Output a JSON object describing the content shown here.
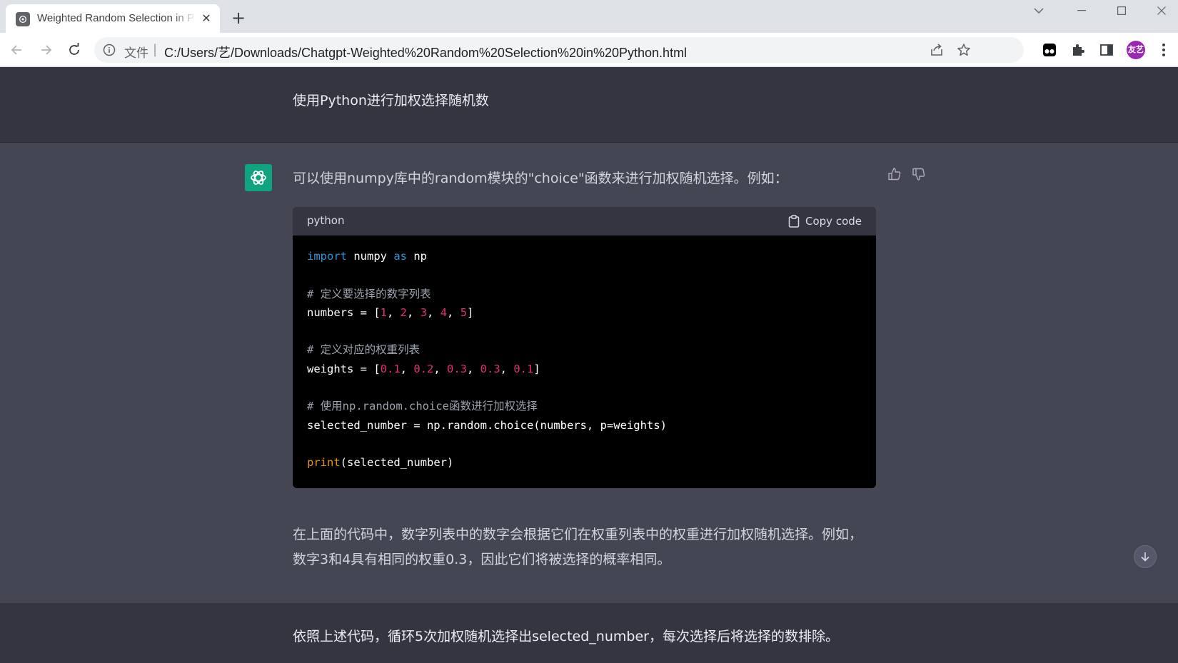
{
  "browser": {
    "tab_title": "Weighted Random Selection in Python",
    "tab_close_glyph": "✕",
    "new_tab_glyph": "+",
    "scheme_label": "文件",
    "url": "C:/Users/艺/Downloads/Chatgpt-Weighted%20Random%20Selection%20in%20Python.html",
    "avatar_text": "友艺"
  },
  "conversation": {
    "user_prompt_1": "使用Python进行加权选择随机数",
    "assistant_intro": "可以使用numpy库中的random模块的\"choice\"函数来进行加权随机选择。例如：",
    "code_language": "python",
    "copy_label": "Copy code",
    "explanation": "在上面的代码中，数字列表中的数字会根据它们在权重列表中的权重进行加权随机选择。例如，数字3和4具有相同的权重0.3，因此它们将被选择的概率相同。",
    "user_prompt_2": "依照上述代码，循环5次加权随机选择出selected_number，每次选择后将选择的数排除。"
  },
  "code": {
    "l1_kw1": "import",
    "l1_mod": " numpy ",
    "l1_kw2": "as",
    "l1_alias": " np",
    "l3_comment": "# 定义要选择的数字列表",
    "l4_var": "numbers = [",
    "l4_n1": "1",
    "l4_n2": "2",
    "l4_n3": "3",
    "l4_n4": "4",
    "l4_n5": "5",
    "l4_end": "]",
    "l6_comment": "# 定义对应的权重列表",
    "l7_var": "weights = [",
    "l7_w1": "0.1",
    "l7_w2": "0.2",
    "l7_w3": "0.3",
    "l7_w4": "0.3",
    "l7_w5": "0.1",
    "l7_end": "]",
    "l9_comment": "# 使用np.random.choice函数进行加权选择",
    "l10": "selected_number = np.random.choice(numbers, p=weights)",
    "l12_fn": "print",
    "l12_args": "(selected_number)",
    "sep": ", "
  },
  "colors": {
    "page_bg": "#444654",
    "user_bg": "#343541",
    "accent_green": "#10a37f",
    "keyword": "#2e95d3",
    "number": "#df3079",
    "function": "#e9950c",
    "comment": "#9ca3af"
  },
  "icons": {
    "favicon": "openai-logo-icon",
    "back": "arrow-left-icon",
    "forward": "arrow-right-icon",
    "reload": "reload-icon",
    "info": "info-icon",
    "share": "share-icon",
    "bookmark": "star-icon",
    "extension_1": "tampermonkey-icon",
    "extensions": "puzzle-icon",
    "side_panel": "side-panel-icon",
    "menu": "kebab-menu-icon",
    "thumbs_up": "thumbs-up-icon",
    "thumbs_down": "thumbs-down-icon",
    "clipboard": "clipboard-icon",
    "scroll_down": "arrow-down-icon"
  }
}
